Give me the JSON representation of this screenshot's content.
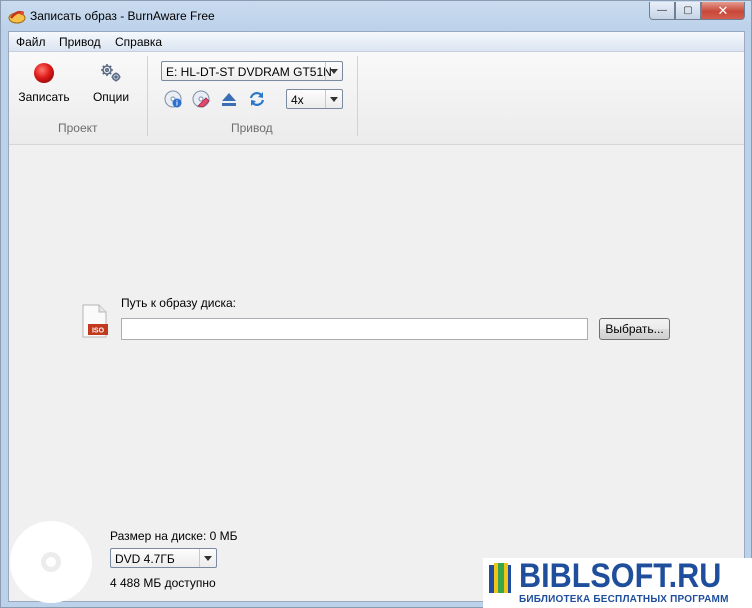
{
  "window": {
    "title": "Записать образ - BurnAware Free",
    "controls": {
      "minimize": "—",
      "maximize": "▢",
      "close": "✕"
    }
  },
  "menu": [
    "Файл",
    "Привод",
    "Справка"
  ],
  "ribbon": {
    "project": {
      "burn_label": "Записать",
      "burn_icon": "record-icon",
      "options_label": "Опции",
      "options_icon": "gears-icon",
      "group_label": "Проект"
    },
    "drive": {
      "selected_drive": "E: HL-DT-ST DVDRAM GT51N",
      "speed": "4x",
      "group_label": "Привод",
      "icons": [
        "disc-info-icon",
        "erase-disc-icon",
        "eject-icon",
        "refresh-icon"
      ]
    }
  },
  "main": {
    "path_label": "Путь к образу диска:",
    "path_value": "",
    "browse_label": "Выбрать...",
    "file_icon_text": "ISO"
  },
  "status": {
    "size_label": "Размер на диске: 0 МБ",
    "disc_type": "DVD 4.7ГБ",
    "available": "4 488 МБ доступно"
  },
  "watermark": {
    "title": "BIBLSOFT.RU",
    "subtitle": "БИБЛИОТЕКА БЕСПЛАТНЫХ ПРОГРАММ"
  },
  "colors": {
    "accent": "#1f4e9c",
    "record": "#d91f1f",
    "close_button": "#c8483a"
  }
}
